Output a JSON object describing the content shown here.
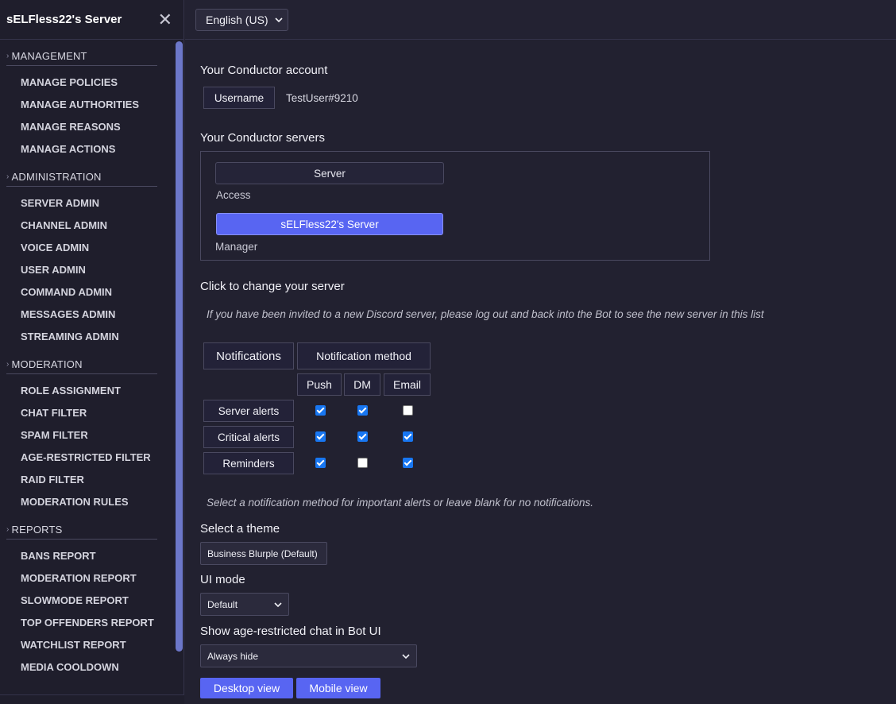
{
  "sidebar": {
    "title": "sELFless22's Server",
    "close_icon": "close-icon",
    "sections": [
      {
        "title": "MANAGEMENT",
        "items": [
          "MANAGE POLICIES",
          "MANAGE AUTHORITIES",
          "MANAGE REASONS",
          "MANAGE ACTIONS"
        ]
      },
      {
        "title": "ADMINISTRATION",
        "items": [
          "SERVER ADMIN",
          "CHANNEL ADMIN",
          "VOICE ADMIN",
          "USER ADMIN",
          "COMMAND ADMIN",
          "MESSAGES ADMIN",
          "STREAMING ADMIN"
        ]
      },
      {
        "title": "MODERATION",
        "items": [
          "ROLE ASSIGNMENT",
          "CHAT FILTER",
          "SPAM FILTER",
          "AGE-RESTRICTED FILTER",
          "RAID FILTER",
          "MODERATION RULES"
        ]
      },
      {
        "title": "REPORTS",
        "items": [
          "BANS REPORT",
          "MODERATION REPORT",
          "SLOWMODE REPORT",
          "TOP OFFENDERS REPORT",
          "WATCHLIST REPORT",
          "MEDIA COOLDOWN"
        ]
      }
    ]
  },
  "topbar": {
    "language": "English (US)"
  },
  "account": {
    "heading": "Your Conductor account",
    "username_label": "Username",
    "username_value": "TestUser#9210"
  },
  "servers": {
    "heading": "Your Conductor servers",
    "column_header": "Server",
    "access_label": "Access",
    "server_name": "sELFless22's Server",
    "role": "Manager"
  },
  "change_server": {
    "heading": "Click to change your server",
    "note": "If you have been invited to a new Discord server, please log out and back into the Bot to see the new server in this list"
  },
  "notifications": {
    "header": "Notifications",
    "method_header": "Notification method",
    "methods": [
      "Push",
      "DM",
      "Email"
    ],
    "rows": [
      {
        "label": "Server alerts",
        "checked": [
          true,
          true,
          false
        ]
      },
      {
        "label": "Critical alerts",
        "checked": [
          true,
          true,
          true
        ]
      },
      {
        "label": "Reminders",
        "checked": [
          true,
          false,
          true
        ]
      }
    ],
    "note": "Select a notification method for important alerts or leave blank for no notifications."
  },
  "theme": {
    "label": "Select a theme",
    "value": "Business Blurple (Default)"
  },
  "ui_mode": {
    "label": "UI mode",
    "value": "Default"
  },
  "age_chat": {
    "label": "Show age-restricted chat in Bot UI",
    "value": "Always hide"
  },
  "views": {
    "desktop": "Desktop view",
    "mobile": "Mobile view"
  },
  "colors": {
    "accent": "#5865f2",
    "background": "#222130",
    "sidebar": "#1f1e2c",
    "checkbox": "#1877f2"
  }
}
